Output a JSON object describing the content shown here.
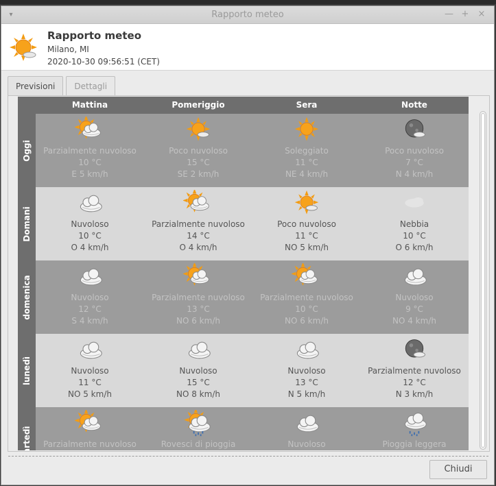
{
  "window": {
    "title": "Rapporto meteo",
    "controls": [
      "—",
      "+",
      "×"
    ]
  },
  "header": {
    "title": "Rapporto meteo",
    "location": "Milano, MI",
    "datetime": "2020-10-30 09:56:51 (CET)"
  },
  "tabs": [
    {
      "label": "Previsioni",
      "active": true
    },
    {
      "label": "Dettagli",
      "active": false
    }
  ],
  "columns": [
    "Mattina",
    "Pomeriggio",
    "Sera",
    "Notte"
  ],
  "rows": [
    {
      "label": "Oggi",
      "cells": [
        {
          "icon": "partly-cloudy-icon",
          "cond": "Parzialmente nuvoloso",
          "temp": "10 °C",
          "wind": "E 5 km/h"
        },
        {
          "icon": "mostly-sunny-icon",
          "cond": "Poco nuvoloso",
          "temp": "15 °C",
          "wind": "SE 2 km/h"
        },
        {
          "icon": "sunny-icon",
          "cond": "Soleggiato",
          "temp": "11 °C",
          "wind": "NE 4 km/h"
        },
        {
          "icon": "moon-cloud-icon",
          "cond": "Poco nuvoloso",
          "temp": "7 °C",
          "wind": "N 4 km/h"
        }
      ]
    },
    {
      "label": "Domani",
      "cells": [
        {
          "icon": "cloudy-icon",
          "cond": "Nuvoloso",
          "temp": "10 °C",
          "wind": "O 4 km/h"
        },
        {
          "icon": "partly-cloudy-icon",
          "cond": "Parzialmente nuvoloso",
          "temp": "14 °C",
          "wind": "O 4 km/h"
        },
        {
          "icon": "mostly-sunny-icon",
          "cond": "Poco nuvoloso",
          "temp": "11 °C",
          "wind": "NO 5 km/h"
        },
        {
          "icon": "fog-icon",
          "cond": "Nebbia",
          "temp": "10 °C",
          "wind": "O 6 km/h"
        }
      ]
    },
    {
      "label": "domenica",
      "cells": [
        {
          "icon": "cloudy-icon",
          "cond": "Nuvoloso",
          "temp": "12 °C",
          "wind": "S 4 km/h"
        },
        {
          "icon": "partly-cloudy-icon",
          "cond": "Parzialmente nuvoloso",
          "temp": "13 °C",
          "wind": "NO 6 km/h"
        },
        {
          "icon": "partly-cloudy-icon",
          "cond": "Parzialmente nuvoloso",
          "temp": "10 °C",
          "wind": "NO 6 km/h"
        },
        {
          "icon": "cloudy-icon",
          "cond": "Nuvoloso",
          "temp": "9 °C",
          "wind": "NO 4 km/h"
        }
      ]
    },
    {
      "label": "lunedì",
      "cells": [
        {
          "icon": "cloudy-icon",
          "cond": "Nuvoloso",
          "temp": "11 °C",
          "wind": "NO 5 km/h"
        },
        {
          "icon": "cloudy-icon",
          "cond": "Nuvoloso",
          "temp": "15 °C",
          "wind": "NO 8 km/h"
        },
        {
          "icon": "cloudy-icon",
          "cond": "Nuvoloso",
          "temp": "13 °C",
          "wind": "N 5 km/h"
        },
        {
          "icon": "moon-cloud-icon",
          "cond": "Parzialmente nuvoloso",
          "temp": "12 °C",
          "wind": "N 3 km/h"
        }
      ]
    },
    {
      "label": "martedì",
      "cells": [
        {
          "icon": "partly-cloudy-icon",
          "cond": "Parzialmente nuvoloso",
          "temp": "",
          "wind": ""
        },
        {
          "icon": "showers-icon",
          "cond": "Rovesci di pioggia",
          "temp": "",
          "wind": ""
        },
        {
          "icon": "cloudy-icon",
          "cond": "Nuvoloso",
          "temp": "",
          "wind": ""
        },
        {
          "icon": "light-rain-icon",
          "cond": "Pioggia leggera",
          "temp": "",
          "wind": ""
        }
      ]
    }
  ],
  "footer": {
    "close_label": "Chiudi"
  },
  "colors": {
    "header_bg": "#6e6e6e",
    "row_dark": "#9c9c9c",
    "row_light": "#d9d9d9",
    "sun": "#f39c12"
  }
}
